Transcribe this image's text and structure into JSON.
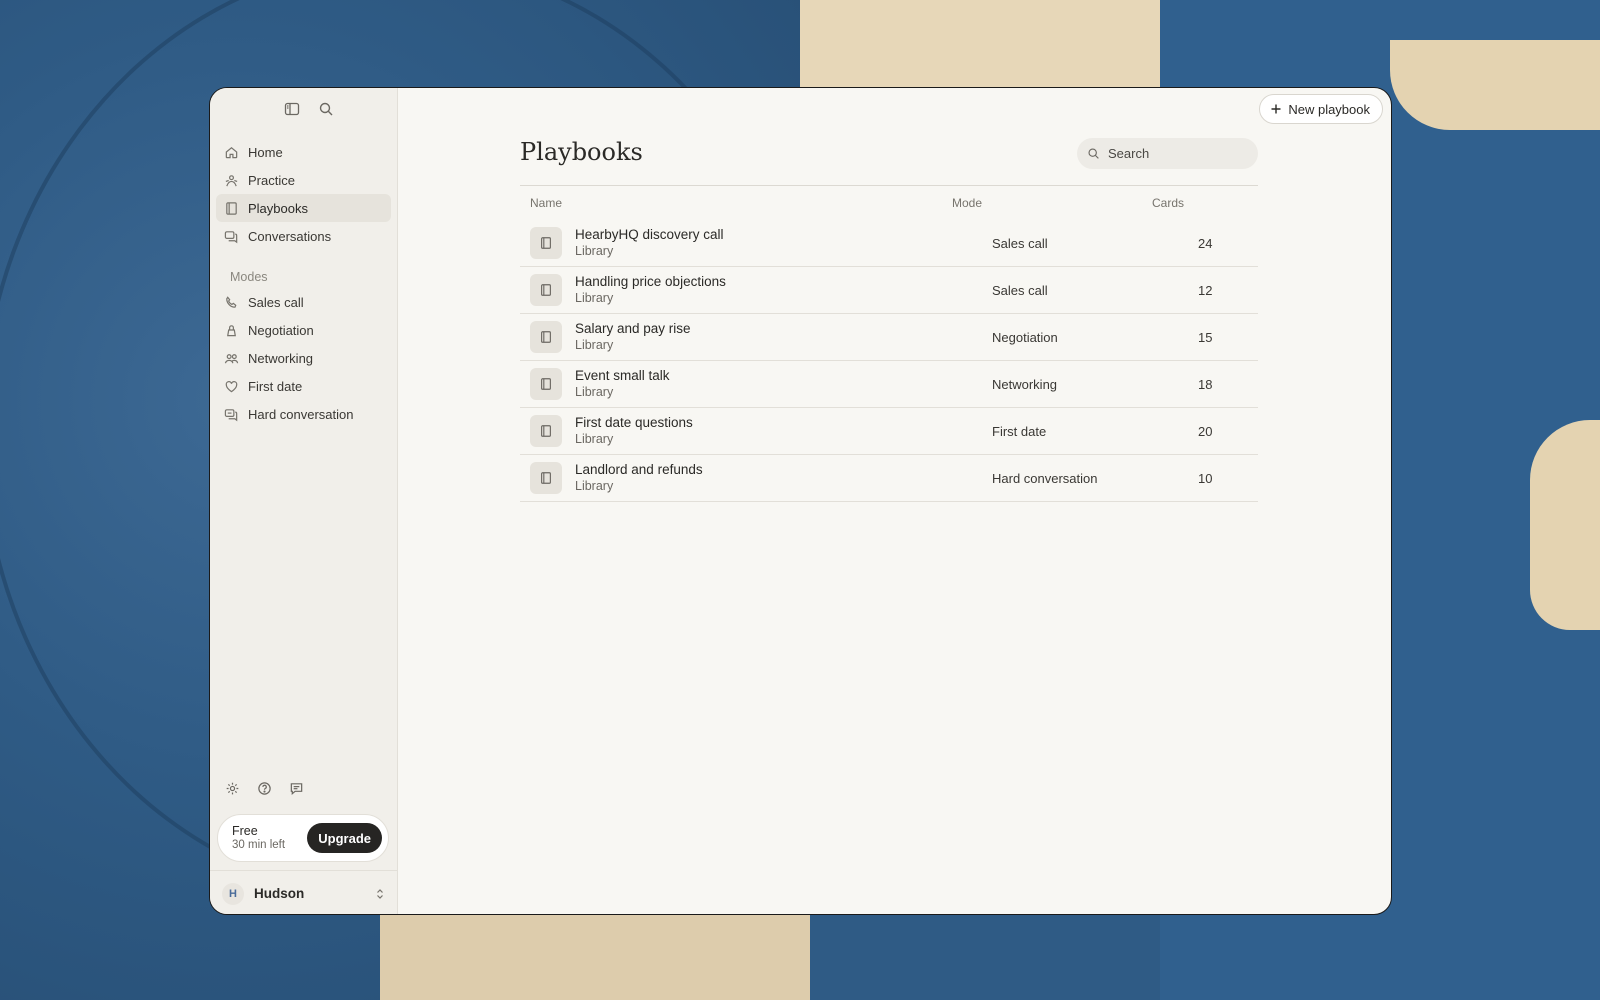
{
  "sidebar": {
    "nav": [
      {
        "label": "Home",
        "icon": "home-icon"
      },
      {
        "label": "Practice",
        "icon": "practice-icon"
      },
      {
        "label": "Playbooks",
        "icon": "book-icon",
        "active": true
      },
      {
        "label": "Conversations",
        "icon": "chat-icon"
      }
    ],
    "modes_label": "Modes",
    "modes": [
      {
        "label": "Sales call",
        "icon": "phone-icon"
      },
      {
        "label": "Negotiation",
        "icon": "scale-icon"
      },
      {
        "label": "Networking",
        "icon": "people-icon"
      },
      {
        "label": "First date",
        "icon": "heart-icon"
      },
      {
        "label": "Hard conversation",
        "icon": "speech-bubbles-icon"
      }
    ],
    "plan": {
      "name": "Free",
      "remaining": "30 min left",
      "upgrade_label": "Upgrade"
    },
    "user": {
      "initial": "H",
      "name": "Hudson"
    }
  },
  "main": {
    "new_button_label": "New playbook",
    "title": "Playbooks",
    "search_placeholder": "Search",
    "columns": {
      "name": "Name",
      "mode": "Mode",
      "cards": "Cards"
    },
    "rows": [
      {
        "title": "HearbyHQ discovery call",
        "source": "Library",
        "mode": "Sales call",
        "cards": "24"
      },
      {
        "title": "Handling price objections",
        "source": "Library",
        "mode": "Sales call",
        "cards": "12"
      },
      {
        "title": "Salary and pay rise",
        "source": "Library",
        "mode": "Negotiation",
        "cards": "15"
      },
      {
        "title": "Event small talk",
        "source": "Library",
        "mode": "Networking",
        "cards": "18"
      },
      {
        "title": "First date questions",
        "source": "Library",
        "mode": "First date",
        "cards": "20"
      },
      {
        "title": "Landlord and refunds",
        "source": "Library",
        "mode": "Hard conversation",
        "cards": "10"
      }
    ]
  },
  "colors": {
    "accent": "#262523",
    "window_bg": "#f8f7f3",
    "sidebar_bg": "#f1efea"
  }
}
